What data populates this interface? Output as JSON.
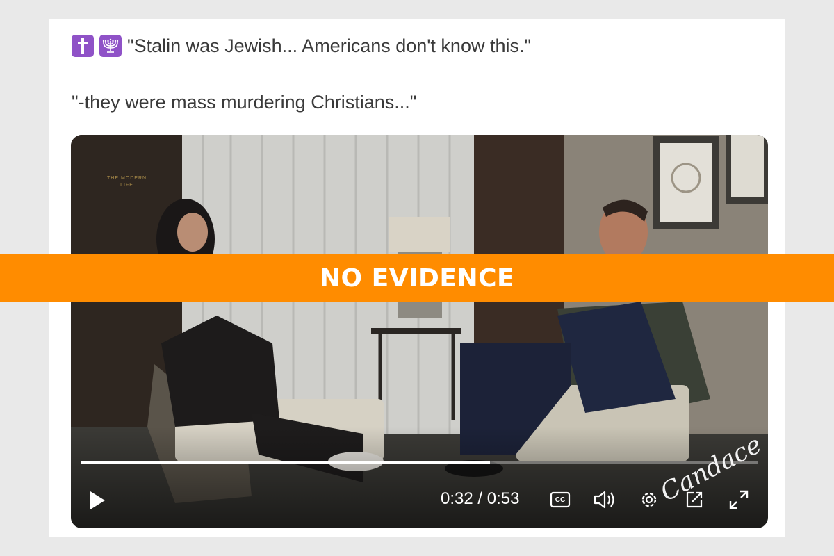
{
  "post": {
    "icons": [
      "latin-cross-emoji",
      "menorah-emoji"
    ],
    "line1": "\"Stalin was Jewish... Americans don't know this.\"",
    "line2": "\"-they were mass murdering Christians...\""
  },
  "video": {
    "brand_top_line1": "THE MODERN",
    "brand_top_line2": "LIFE",
    "signature": "Candace",
    "time_display": "0:32 / 0:53",
    "progress_fraction": 0.604,
    "icons": [
      "play-icon",
      "captions-icon",
      "volume-icon",
      "settings-icon",
      "popout-icon",
      "fullscreen-icon"
    ],
    "captions_label": "CC"
  },
  "banner": {
    "label": "NO EVIDENCE",
    "color": "#ff8c00"
  }
}
